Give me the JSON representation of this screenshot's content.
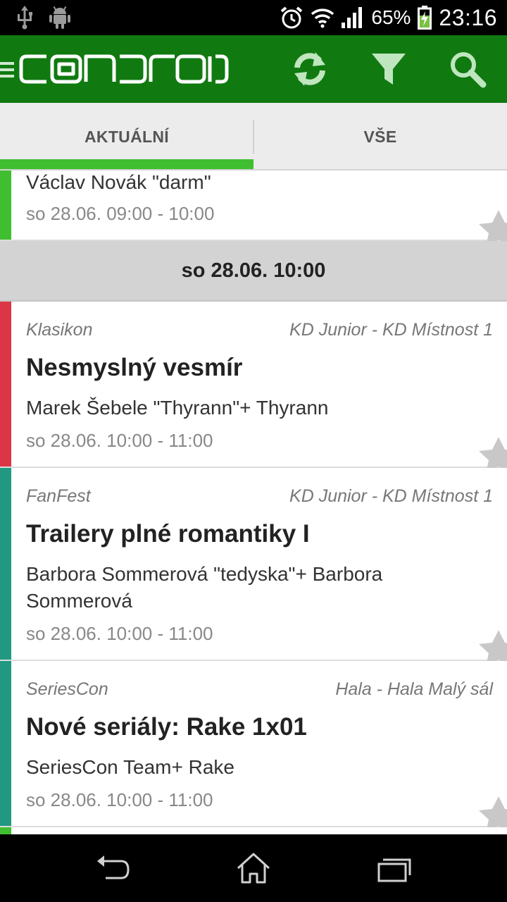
{
  "status_bar": {
    "battery_pct": "65%",
    "time": "23:16",
    "icons": [
      "usb-icon",
      "android-debug-icon",
      "alarm-icon",
      "wifi-icon",
      "signal-icon",
      "battery-charging-icon"
    ]
  },
  "action_bar": {
    "app_logo": "CONDROID",
    "actions": [
      "refresh-icon",
      "filter-icon",
      "search-icon"
    ],
    "color": "#107a10"
  },
  "tabs": [
    {
      "label": "AKTUÁLNÍ",
      "selected": true
    },
    {
      "label": "VŠE",
      "selected": false
    }
  ],
  "colors": {
    "tab_indicator": "#3fbf2f",
    "program_green": "#3fbf2f",
    "program_red": "#dc3545",
    "program_teal": "#219882"
  },
  "list": {
    "partial_item": {
      "people": "Václav Novák \"darm\"",
      "time": "so 28.06. 09:00 - 10:00"
    },
    "section_header": "so 28.06. 10:00",
    "items": [
      {
        "program": "Klasikon",
        "location": "KD Junior - KD Místnost 1",
        "title": "Nesmyslný vesmír",
        "people": "Marek Šebele \"Thyrann\"+ Thyrann",
        "time": "so 28.06. 10:00 - 11:00"
      },
      {
        "program": "FanFest",
        "location": "KD Junior - KD Místnost 1",
        "title": "Trailery plné romantiky I",
        "people": "Barbora Sommerová \"tedyska\"+ Barbora Sommerová",
        "time": "so 28.06. 10:00 - 11:00"
      },
      {
        "program": "SeriesCon",
        "location": "Hala - Hala Malý sál",
        "title": "Nové seriály: Rake 1x01",
        "people": "SeriesCon Team+ Rake",
        "time": "so 28.06. 10:00 - 11:00"
      }
    ]
  },
  "nav_bar": [
    "back-icon",
    "home-icon",
    "recent-apps-icon"
  ]
}
